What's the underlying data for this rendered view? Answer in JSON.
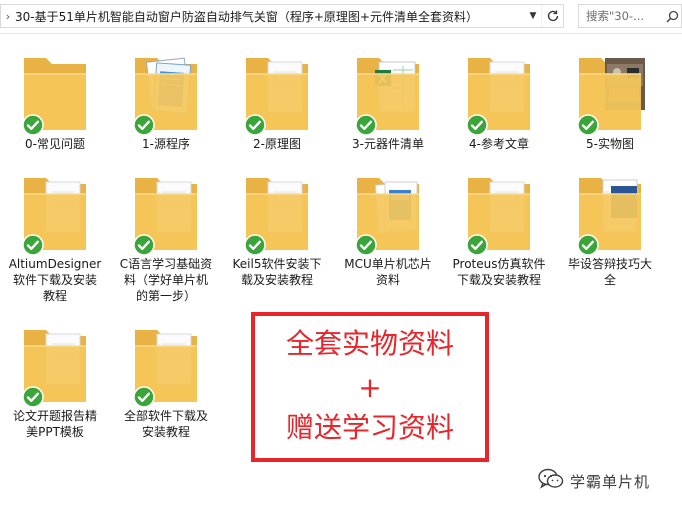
{
  "address_bar": {
    "path": "30-基于51单片机智能自动窗户防盗自动排气关窗（程序+原理图+元件清单全套资料）",
    "search_placeholder": "搜索\"30-..."
  },
  "items": [
    {
      "label": "0-常见问题",
      "kind": "folder"
    },
    {
      "label": "1-源程序",
      "kind": "folder-notepad"
    },
    {
      "label": "2-原理图",
      "kind": "folder-doc"
    },
    {
      "label": "3-元器件清单",
      "kind": "folder-excel"
    },
    {
      "label": "4-参考文章",
      "kind": "folder-doc"
    },
    {
      "label": "5-实物图",
      "kind": "folder-photo"
    },
    {
      "label": "AltiumDesigner软件下载及安装教程",
      "kind": "folder-doc"
    },
    {
      "label": "C语言学习基础资料（学好单片机的第一步）",
      "kind": "folder-doc"
    },
    {
      "label": "Keil5软件安装下载及安装教程",
      "kind": "folder-doc"
    },
    {
      "label": "MCU单片机芯片资料",
      "kind": "folder-docs"
    },
    {
      "label": "Proteus仿真软件下载及安装教程",
      "kind": "folder-doc"
    },
    {
      "label": "毕设答辩技巧大全",
      "kind": "folder-word"
    },
    {
      "label": "论文开题报告精美PPT模板",
      "kind": "folder-doc"
    },
    {
      "label": "全部软件下载及安装教程",
      "kind": "folder-doc"
    }
  ],
  "labels_display": [
    [
      "0-常见问题"
    ],
    [
      "1-源程序"
    ],
    [
      "2-原理图"
    ],
    [
      "3-元器件清单"
    ],
    [
      "4-参考文章"
    ],
    [
      "5-实物图"
    ],
    [
      "AltiumDesigner",
      "软件下载及安装",
      "教程"
    ],
    [
      "C语言学习基础资",
      "料（学好单片机",
      "的第一步）"
    ],
    [
      "Keil5软件安装下",
      "载及安装教程"
    ],
    [
      "MCU单片机芯片",
      "资料"
    ],
    [
      "Proteus仿真软件",
      "下载及安装教程"
    ],
    [
      "毕设答辩技巧大",
      "全"
    ],
    [
      "论文开题报告精",
      "美PPT模板"
    ],
    [
      "全部软件下载及",
      "安装教程"
    ]
  ],
  "promo": {
    "line1": "全套实物资料",
    "line2": "+",
    "line3": "赠送学习资料",
    "color": "#e8252b"
  },
  "watermark": {
    "text": "学霸单片机",
    "icon": "wechat-icon"
  },
  "colors": {
    "folder": "#f5c75a",
    "folder_dark": "#e8b245",
    "check": "#3aa53a"
  }
}
